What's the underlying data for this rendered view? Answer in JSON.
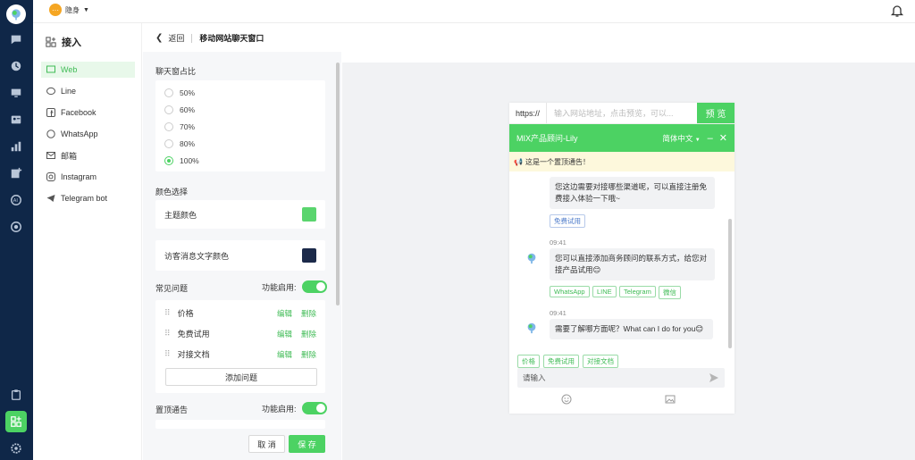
{
  "topbar": {
    "status_label": "隐身"
  },
  "menu": {
    "heading": "接入",
    "items": [
      {
        "label": "Web",
        "icon": "web-icon",
        "selected": true
      },
      {
        "label": "Line",
        "icon": "line-icon"
      },
      {
        "label": "Facebook",
        "icon": "facebook-icon"
      },
      {
        "label": "WhatsApp",
        "icon": "whatsapp-icon"
      },
      {
        "label": "邮箱",
        "icon": "mail-icon"
      },
      {
        "label": "Instagram",
        "icon": "instagram-icon"
      },
      {
        "label": "Telegram bot",
        "icon": "telegram-icon"
      }
    ]
  },
  "header": {
    "back_label": "返回",
    "title": "移动网站聊天窗口"
  },
  "editor": {
    "ratio_label": "聊天窗占比",
    "ratios": [
      "50%",
      "60%",
      "70%",
      "80%",
      "100%"
    ],
    "ratio_selected": "100%",
    "color_label": "颜色选择",
    "theme_color_label": "主题颜色",
    "theme_color": "#5ad56e",
    "visitor_color_label": "访客消息文字颜色",
    "visitor_color": "#1c2a4a",
    "faq_label": "常见问题",
    "faq_toggle_label": "功能启用:",
    "faq_items": [
      "价格",
      "免费试用",
      "对接文档"
    ],
    "edit_label": "编辑",
    "delete_label": "删除",
    "add_question_label": "添加问题",
    "pin_notice_label": "置顶通告",
    "pin_toggle_label": "功能启用:",
    "cancel_label": "取 消",
    "save_label": "保 存"
  },
  "preview": {
    "protocol": "https://",
    "url_placeholder": "输入网站地址，点击预览，可以...",
    "preview_button": "预 览",
    "chat_title": "MIX产品顾问-Lily",
    "language": "简体中文",
    "notice": "这是一个置顶通告！",
    "messages": [
      {
        "text": "您这边需要对接哪些渠道呢，可以直接注册免费接入体验一下哦~",
        "tags": [
          "免费试用"
        ]
      },
      {
        "time": "09:41",
        "text": "您可以直接添加商务顾问的联系方式，给您对接产品试用😊",
        "tags": [
          "WhatsApp",
          "LINE",
          "Telegram",
          "微信"
        ]
      },
      {
        "time": "09:41",
        "text": "需要了解哪方面呢？What can I do for you😊"
      }
    ],
    "quick_replies": [
      "价格",
      "免费试用",
      "对接文档"
    ],
    "input_placeholder": "请输入"
  },
  "colors": {
    "accent": "#4cd263",
    "rail": "#0f2748"
  }
}
